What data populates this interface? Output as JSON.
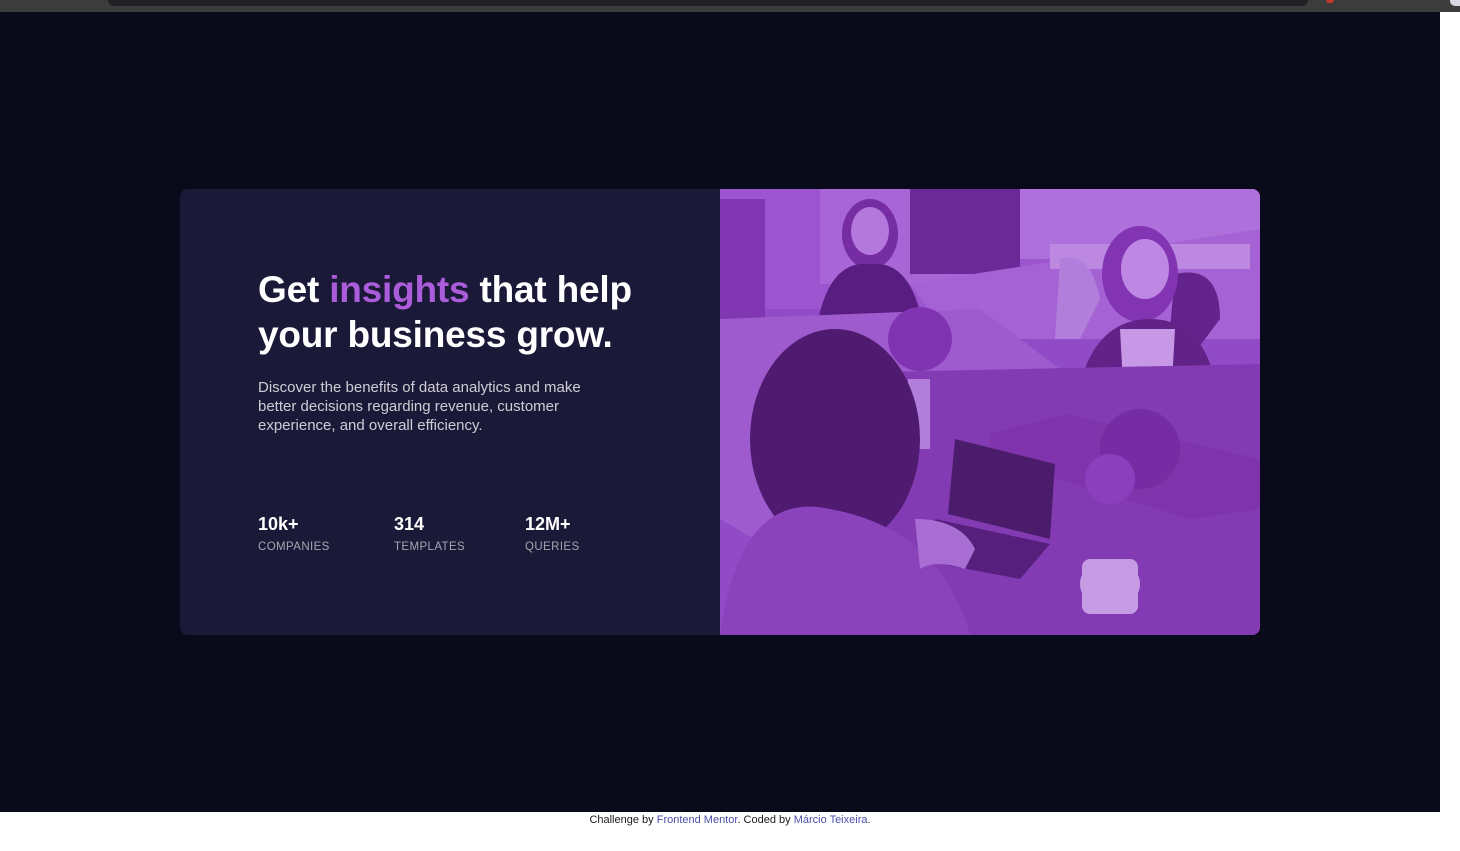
{
  "hero": {
    "title_before": "Get",
    "title_accent": "insights",
    "title_after": "that help your business grow.",
    "description": "Discover the benefits of data analytics and make better decisions regarding revenue, customer experience, and overall efficiency."
  },
  "stats": [
    {
      "value": "10k+",
      "label": "Companies"
    },
    {
      "value": "314",
      "label": "Templates"
    },
    {
      "value": "12M+",
      "label": "Queries"
    }
  ],
  "footer": {
    "prefix": "Challenge by",
    "mentor_link": "Frontend Mentor",
    "middle": ". Coded by",
    "author_link": "Márcio Teixeira",
    "suffix": "."
  },
  "colors": {
    "page_background": "#090b1a",
    "card_background": "#1b1938",
    "accent": "#aa5cdb",
    "image_overlay": "#8b40c4",
    "link": "#4a4fa8"
  },
  "icons": {
    "image": "office-team-photo"
  }
}
